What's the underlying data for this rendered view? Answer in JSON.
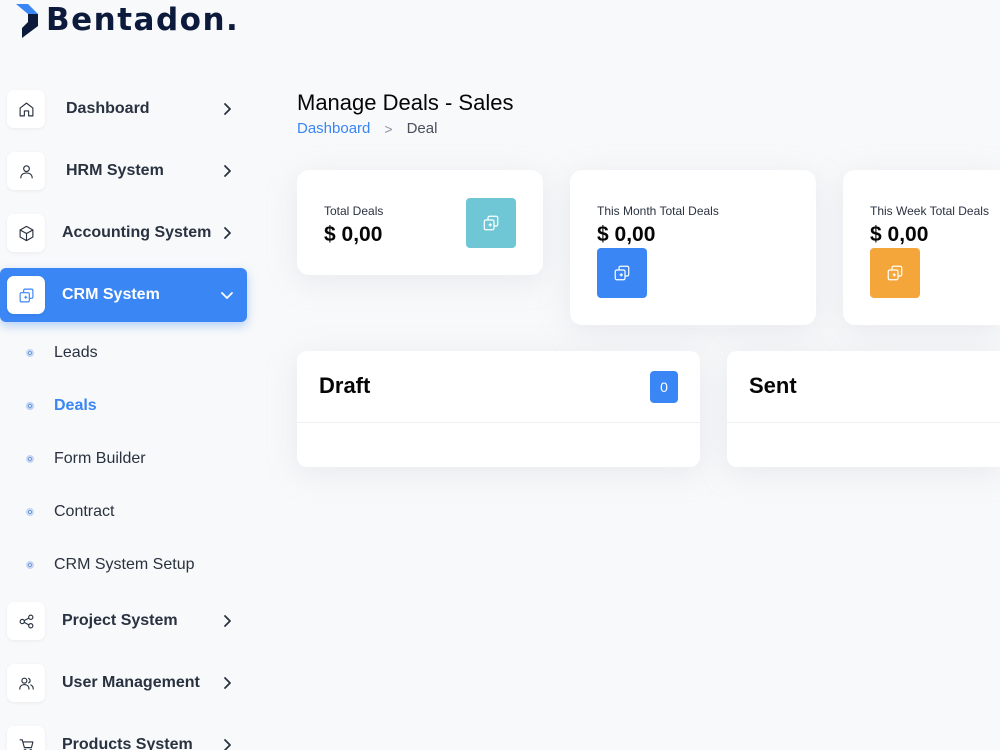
{
  "brand": {
    "name": "Bentadon.",
    "logo_color": "#0c1a3c"
  },
  "sidebar": {
    "items": [
      {
        "label": "Dashboard",
        "icon": "home-icon"
      },
      {
        "label": "HRM System",
        "icon": "user-icon"
      },
      {
        "label": "Accounting System",
        "icon": "box-icon"
      },
      {
        "label": "CRM System",
        "icon": "layers-icon",
        "active": true,
        "expanded": true
      },
      {
        "label": "Project System",
        "icon": "share-icon"
      },
      {
        "label": "User Management",
        "icon": "users-icon"
      },
      {
        "label": "Products System",
        "icon": "cart-icon"
      }
    ],
    "crm_sub_items": [
      {
        "label": "Leads"
      },
      {
        "label": "Deals",
        "active": true
      },
      {
        "label": "Form Builder"
      },
      {
        "label": "Contract"
      },
      {
        "label": "CRM System Setup"
      }
    ]
  },
  "header": {
    "title": "Manage Deals - Sales",
    "breadcrumb": {
      "link": "Dashboard",
      "separator": ">",
      "current": "Deal"
    }
  },
  "stats": [
    {
      "title": "Total Deals",
      "value": "$ 0,00",
      "icon": "layers-icon",
      "color": "#6fc6d5"
    },
    {
      "title": "This Month Total Deals",
      "value": "$ 0,00",
      "icon": "layers-icon",
      "color": "#3a86f4"
    },
    {
      "title": "This Week Total Deals",
      "value": "$ 0,00",
      "icon": "layers-icon",
      "color": "#f4a63a"
    }
  ],
  "stages": [
    {
      "name": "Draft",
      "count": "0"
    },
    {
      "name": "Sent",
      "count": ""
    }
  ],
  "colors": {
    "accent": "#3a86f4",
    "teal": "#6fc6d5",
    "orange": "#f4a63a"
  }
}
